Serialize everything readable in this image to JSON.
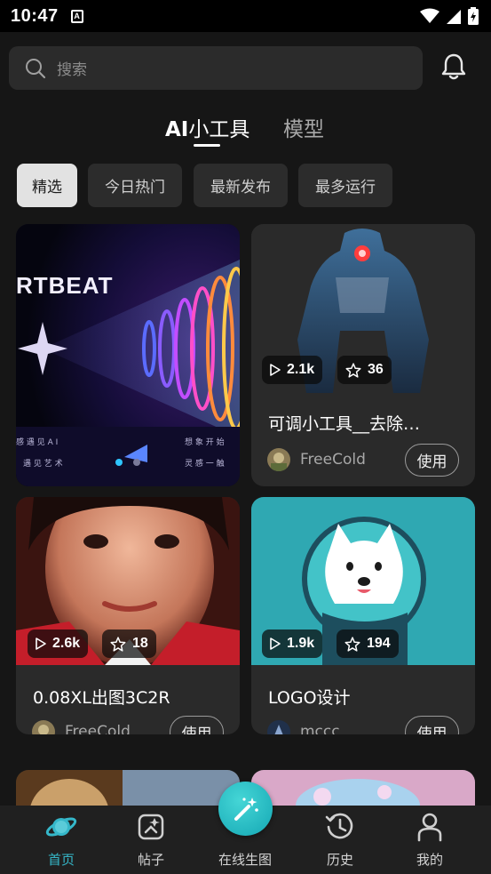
{
  "status_bar": {
    "time": "10:47"
  },
  "search": {
    "placeholder": "搜索"
  },
  "tabs": [
    {
      "prefix": "AI",
      "label": "小工具",
      "active": true
    },
    {
      "label": "模型",
      "active": false
    }
  ],
  "filters": [
    "精选",
    "今日热门",
    "最新发布",
    "最多运行"
  ],
  "active_filter": "精选",
  "cards": [
    {
      "thumb_text": "RTBEAT",
      "thumb_footer_left": "感 遇 见 A I",
      "thumb_footer_left2": "遇 见 艺 术",
      "thumb_footer_right": "想 象 开 始",
      "thumb_footer_right2": "灵 感 一 触"
    },
    {
      "plays": "2.1k",
      "stars": "36",
      "title": "可调小工具__去除…",
      "author": "FreeCold",
      "button": "使用"
    },
    {
      "plays": "2.6k",
      "stars": "18",
      "title": "0.08XL出图3C2R",
      "author": "FreeCold",
      "button": "使用"
    },
    {
      "plays": "1.9k",
      "stars": "194",
      "title": "LOGO设计",
      "author": "mccc",
      "button": "使用"
    }
  ],
  "bottom_nav": [
    {
      "label": "首页",
      "icon": "planet-icon",
      "active": true
    },
    {
      "label": "帖子",
      "icon": "post-icon",
      "active": false
    },
    {
      "label": "在线生图",
      "icon": "magic-wand-icon",
      "active": false
    },
    {
      "label": "历史",
      "icon": "history-icon",
      "active": false
    },
    {
      "label": "我的",
      "icon": "person-icon",
      "active": false
    }
  ],
  "colors": {
    "accent": "#35b7c9",
    "background": "#161616",
    "card": "#2a2a2a"
  }
}
